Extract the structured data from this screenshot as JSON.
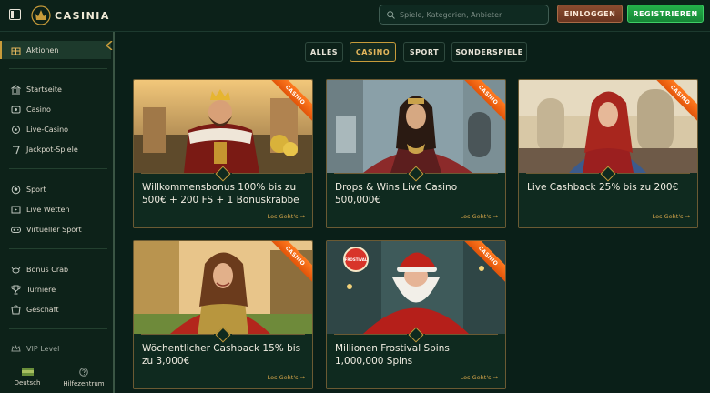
{
  "header": {
    "logo_text": "CASINIA",
    "search_placeholder": "Spiele, Kategorien, Anbieter",
    "login_label": "EINLOGGEN",
    "register_label": "REGISTRIEREN"
  },
  "sidebar": {
    "active_label": "Aktionen",
    "items": [
      {
        "label": "Startseite",
        "icon": "bank-icon"
      },
      {
        "label": "Casino",
        "icon": "casino-chip-icon"
      },
      {
        "label": "Live-Casino",
        "icon": "live-icon"
      },
      {
        "label": "Jackpot-Spiele",
        "icon": "jackpot-icon"
      },
      {
        "label": "Sport",
        "icon": "ball-icon"
      },
      {
        "label": "Live Wetten",
        "icon": "live-bet-icon"
      },
      {
        "label": "Virtueller Sport",
        "icon": "gamepad-icon"
      },
      {
        "label": "Bonus Crab",
        "icon": "crab-icon"
      },
      {
        "label": "Turniere",
        "icon": "trophy-icon"
      },
      {
        "label": "Geschäft",
        "icon": "shop-icon"
      },
      {
        "label": "VIP Level",
        "icon": "crown-icon"
      }
    ],
    "footer": {
      "language_label": "Deutsch",
      "help_label": "Hilfezentrum"
    }
  },
  "filters": [
    "ALLES",
    "CASINO",
    "SPORT",
    "SONDERSPIELE"
  ],
  "active_filter": "CASINO",
  "cards": [
    {
      "title": "Willkommensbonus 100% bis zu 500€ + 200 FS + 1 Bonuskrabbe",
      "badge": "CASINO",
      "cta": "Los Geht's →"
    },
    {
      "title": "Drops & Wins Live Casino 500,000€",
      "badge": "CASINO",
      "cta": "Los Geht's →"
    },
    {
      "title": "Live Cashback 25% bis zu 200€",
      "badge": "CASINO",
      "cta": "Los Geht's →"
    },
    {
      "title": "Wöchentlicher Cashback 15% bis zu 3,000€",
      "badge": "CASINO",
      "cta": "Los Geht's →"
    },
    {
      "title": "Millionen Frostival Spins 1,000,000 Spins",
      "badge": "CASINO",
      "cta": "Los Geht's →",
      "stamp": "FROSTIVAL"
    }
  ],
  "colors": {
    "accent_gold": "#c79b3a",
    "register_green": "#1f9e43",
    "login_brown": "#7a4028",
    "badge_orange": "#f06414",
    "background": "#0a1f18"
  }
}
